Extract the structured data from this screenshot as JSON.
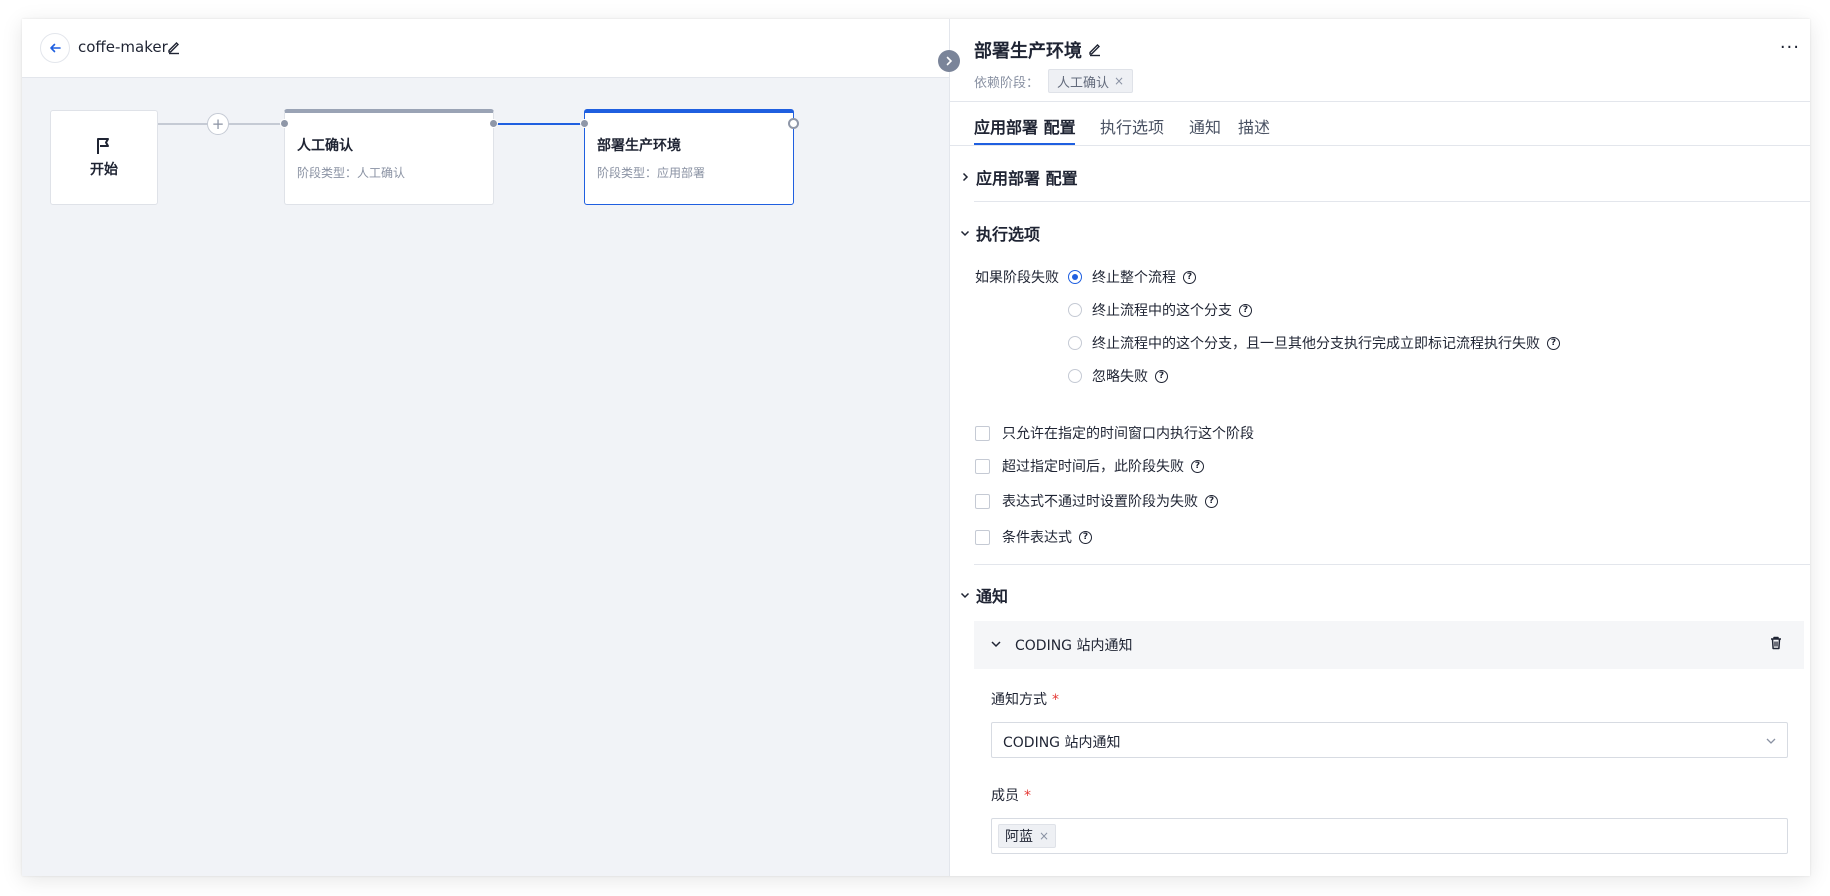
{
  "header": {
    "project_name": "coffe-maker"
  },
  "pipeline": {
    "start_label": "开始",
    "add_label": "+",
    "stages": [
      {
        "title": "人工确认",
        "sub": "阶段类型：人工确认"
      },
      {
        "title": "部署生产环境",
        "sub": "阶段类型：应用部署"
      }
    ]
  },
  "panel": {
    "title": "部署生产环境",
    "more": "···",
    "dependency_label": "依赖阶段：",
    "dependency_tag": "人工确认",
    "tabs": [
      "应用部署 配置",
      "执行选项",
      "通知",
      "描述"
    ],
    "sections": {
      "deploy": "应用部署 配置",
      "exec": "执行选项",
      "notify": "通知"
    },
    "fail_label": "如果阶段失败",
    "radios": [
      "终止整个流程",
      "终止流程中的这个分支",
      "终止流程中的这个分支，且一旦其他分支执行完成立即标记流程执行失败",
      "忽略失败"
    ],
    "checkboxes": [
      "只允许在指定的时间窗口内执行这个阶段",
      "超过指定时间后，此阶段失败",
      "表达式不通过时设置阶段为失败",
      "条件表达式"
    ],
    "notify_card_title": "CODING 站内通知",
    "notify_method_label": "通知方式",
    "notify_method_value": "CODING 站内通知",
    "members_label": "成员",
    "member": "阿蓝",
    "required_mark": "*",
    "remove_mark": "×",
    "help_mark": "?"
  },
  "colors": {
    "accent": "#1f5fe0",
    "canvas": "#f1f3f7",
    "required": "#e53935"
  }
}
